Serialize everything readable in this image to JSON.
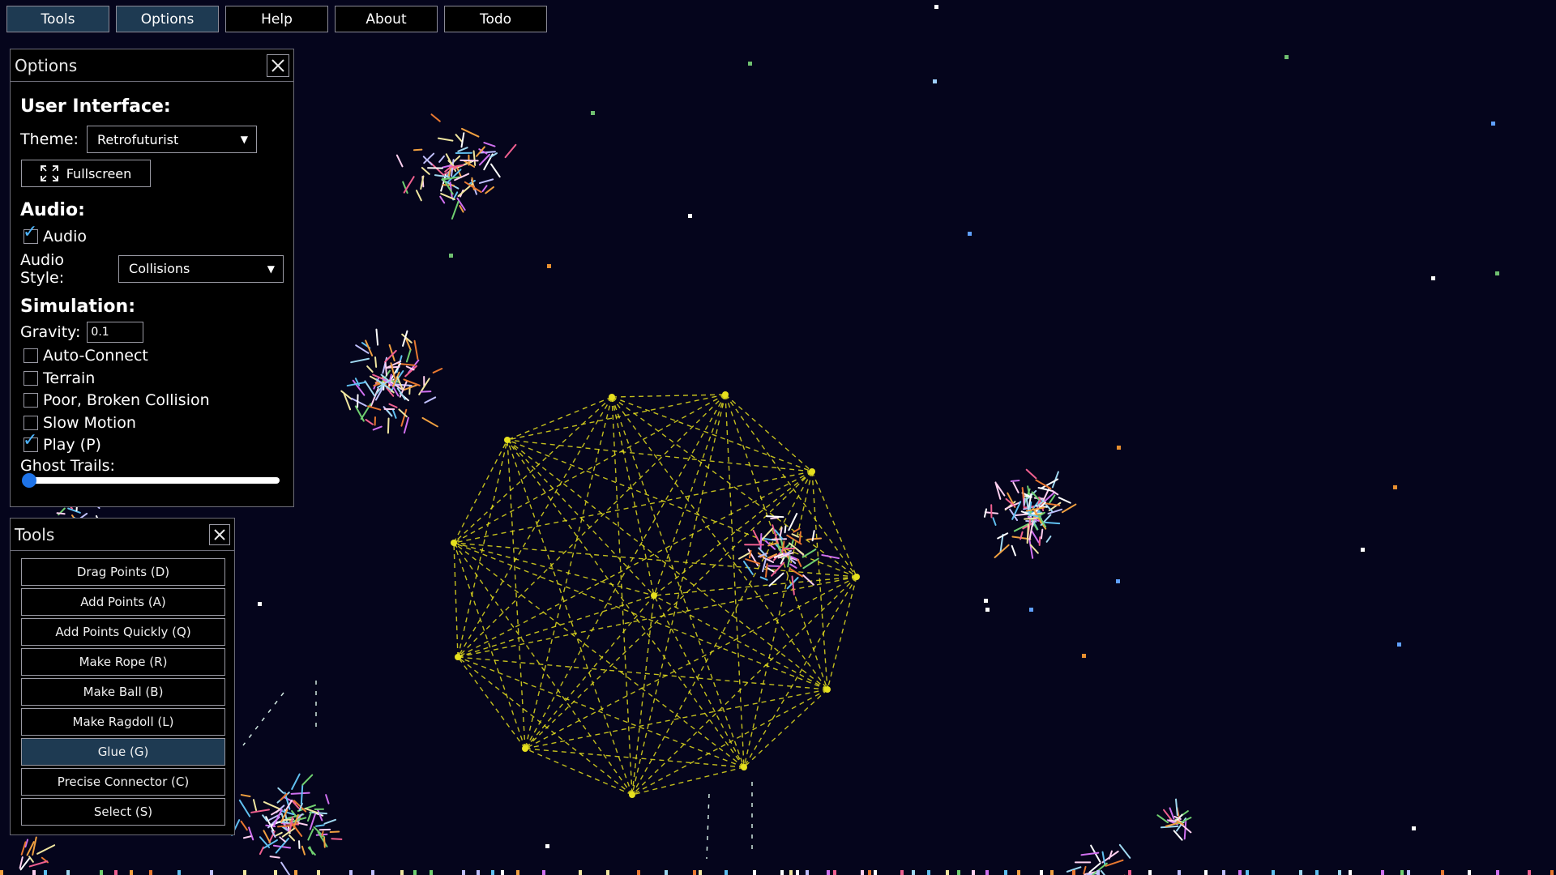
{
  "menu": [
    {
      "label": "Tools",
      "active": true
    },
    {
      "label": "Options",
      "active": true
    },
    {
      "label": "Help",
      "active": false
    },
    {
      "label": "About",
      "active": false
    },
    {
      "label": "Todo",
      "active": false
    }
  ],
  "options_panel": {
    "title": "Options",
    "ui_heading": "User Interface:",
    "theme_label": "Theme:",
    "theme_value": "Retrofuturist",
    "fullscreen_label": "Fullscreen",
    "audio_heading": "Audio:",
    "audio_checkbox": {
      "label": "Audio",
      "checked": true
    },
    "audio_style_label": "Audio Style:",
    "audio_style_value": "Collisions",
    "simulation_heading": "Simulation:",
    "gravity_label": "Gravity:",
    "gravity_value": "0.1",
    "checkboxes": [
      {
        "label": "Auto-Connect",
        "checked": false
      },
      {
        "label": "Terrain",
        "checked": false
      },
      {
        "label": "Poor, Broken Collision",
        "checked": false
      },
      {
        "label": "Slow Motion",
        "checked": false
      },
      {
        "label": "Play (P)",
        "checked": true
      }
    ],
    "ghost_trails_label": "Ghost Trails:",
    "ghost_trails_value": 0
  },
  "tools_panel": {
    "title": "Tools",
    "tools": [
      {
        "label": "Drag Points (D)",
        "active": false
      },
      {
        "label": "Add Points (A)",
        "active": false
      },
      {
        "label": "Add Points Quickly (Q)",
        "active": false
      },
      {
        "label": "Make Rope (R)",
        "active": false
      },
      {
        "label": "Make Ball (B)",
        "active": false
      },
      {
        "label": "Make Ragdoll (L)",
        "active": false
      },
      {
        "label": "Glue (G)",
        "active": true
      },
      {
        "label": "Precise Connector (C)",
        "active": false
      },
      {
        "label": "Select (S)",
        "active": false
      }
    ]
  },
  "colors": {
    "background": "#05051c",
    "ball": "#e6e01e",
    "active_button": "#1e3a52",
    "checkmark": "#4fb5ff",
    "slider_thumb": "#1e73e8"
  }
}
